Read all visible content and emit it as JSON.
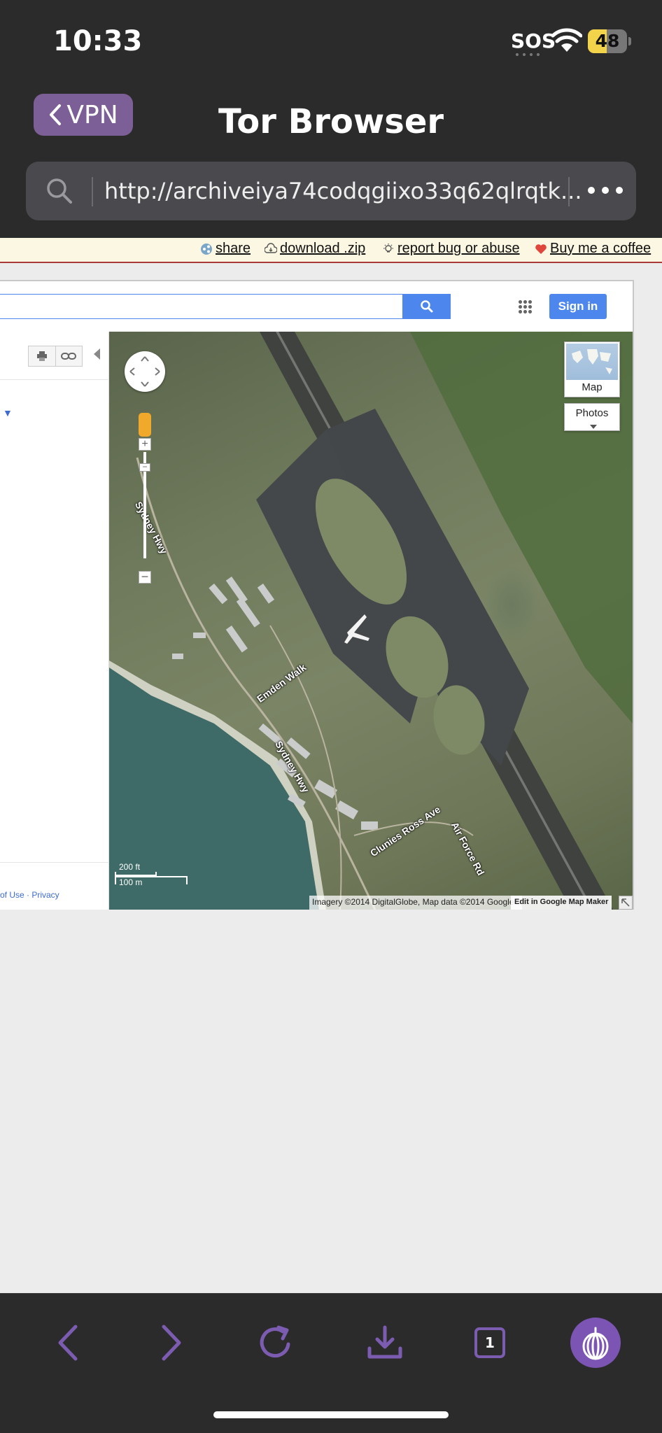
{
  "status_bar": {
    "time": "10:33",
    "sos": "SOS",
    "battery": "48",
    "battery_level": 0.48
  },
  "nav": {
    "back_label": "VPN",
    "title": "Tor Browser"
  },
  "url_bar": {
    "url": "http://archiveiya74codqgiixo33q62qlrqtk..."
  },
  "archive_bar": {
    "share": "share",
    "download": "download .zip",
    "report": "report bug or abuse",
    "coffee": "Buy me a coffee"
  },
  "maps": {
    "sign_in": "Sign in",
    "footer": "of Use · Privacy",
    "map_type": "Map",
    "photos": "Photos",
    "scale_ft": "200 ft",
    "scale_m": "100 m",
    "attribution": "Imagery ©2014 DigitalGlobe, Map data ©2014 Google -",
    "edit_link": "Edit in Google Map Maker",
    "labels": {
      "sydney1": "Sydney Hwy",
      "emden": "Emden Walk",
      "sydney2": "Sydney Hwy",
      "clunies": "Clunies Ross Ave",
      "airforce": "Air Force Rd"
    }
  },
  "toolbar": {
    "tab_count": "1"
  },
  "colors": {
    "accent": "#7c5cb1",
    "chrome": "#2b2b2b",
    "link_blue": "#4d87ee"
  }
}
